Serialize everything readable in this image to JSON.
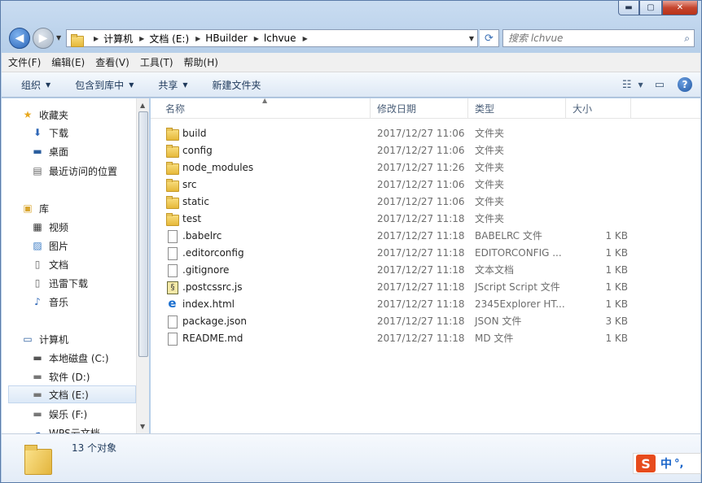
{
  "window": {
    "controls": {
      "minimize": "▬",
      "maximize": "▢",
      "close": "✕"
    }
  },
  "address": {
    "crumbs": [
      "计算机",
      "文档 (E:)",
      "HBuilder",
      "lchvue"
    ]
  },
  "search": {
    "placeholder": "搜索 lchvue"
  },
  "menu": [
    "文件(F)",
    "编辑(E)",
    "查看(V)",
    "工具(T)",
    "帮助(H)"
  ],
  "commands": [
    "组织",
    "包含到库中",
    "共享",
    "新建文件夹"
  ],
  "nav": {
    "favorites": {
      "label": "收藏夹",
      "items": [
        "下载",
        "桌面",
        "最近访问的位置"
      ]
    },
    "libraries": {
      "label": "库",
      "items": [
        "视频",
        "图片",
        "文档",
        "迅雷下载",
        "音乐"
      ]
    },
    "computer": {
      "label": "计算机",
      "items": [
        "本地磁盘 (C:)",
        "软件 (D:)",
        "文档 (E:)",
        "娱乐 (F:)",
        "WPS云文档"
      ]
    }
  },
  "columns": {
    "name": "名称",
    "date": "修改日期",
    "type": "类型",
    "size": "大小"
  },
  "files": [
    {
      "name": "build",
      "date": "2017/12/27 11:06",
      "type": "文件夹",
      "size": "",
      "icon": "folder"
    },
    {
      "name": "config",
      "date": "2017/12/27 11:06",
      "type": "文件夹",
      "size": "",
      "icon": "folder"
    },
    {
      "name": "node_modules",
      "date": "2017/12/27 11:26",
      "type": "文件夹",
      "size": "",
      "icon": "folder"
    },
    {
      "name": "src",
      "date": "2017/12/27 11:06",
      "type": "文件夹",
      "size": "",
      "icon": "folder"
    },
    {
      "name": "static",
      "date": "2017/12/27 11:06",
      "type": "文件夹",
      "size": "",
      "icon": "folder"
    },
    {
      "name": "test",
      "date": "2017/12/27 11:18",
      "type": "文件夹",
      "size": "",
      "icon": "folder"
    },
    {
      "name": ".babelrc",
      "date": "2017/12/27 11:18",
      "type": "BABELRC 文件",
      "size": "1 KB",
      "icon": "file"
    },
    {
      "name": ".editorconfig",
      "date": "2017/12/27 11:18",
      "type": "EDITORCONFIG ...",
      "size": "1 KB",
      "icon": "file"
    },
    {
      "name": ".gitignore",
      "date": "2017/12/27 11:18",
      "type": "文本文档",
      "size": "1 KB",
      "icon": "file"
    },
    {
      "name": ".postcssrc.js",
      "date": "2017/12/27 11:18",
      "type": "JScript Script 文件",
      "size": "1 KB",
      "icon": "js"
    },
    {
      "name": "index.html",
      "date": "2017/12/27 11:18",
      "type": "2345Explorer HT...",
      "size": "1 KB",
      "icon": "ie"
    },
    {
      "name": "package.json",
      "date": "2017/12/27 11:18",
      "type": "JSON 文件",
      "size": "3 KB",
      "icon": "file"
    },
    {
      "name": "README.md",
      "date": "2017/12/27 11:18",
      "type": "MD 文件",
      "size": "1 KB",
      "icon": "file"
    }
  ],
  "status": {
    "count": "13 个对象"
  },
  "ime": {
    "logo": "S",
    "lang": "中",
    "punct": "°,"
  }
}
